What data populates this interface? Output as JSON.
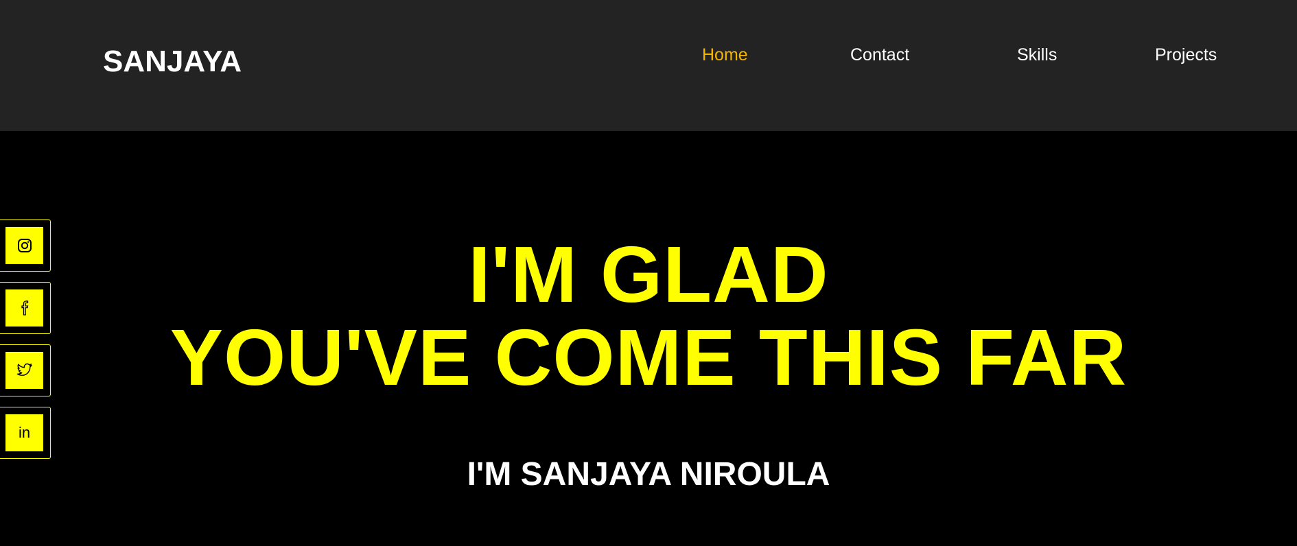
{
  "header": {
    "logo": "SANJAYA",
    "nav": {
      "home": "Home",
      "contact": "Contact",
      "skills": "Skills",
      "projects": "Projects"
    },
    "active_item": "Home"
  },
  "social": {
    "items": [
      {
        "name": "instagram",
        "icon": "instagram-icon"
      },
      {
        "name": "facebook",
        "icon": "facebook-icon"
      },
      {
        "name": "twitter",
        "icon": "twitter-icon"
      },
      {
        "name": "linkedin",
        "icon": "linkedin-icon",
        "glyph": "in"
      }
    ]
  },
  "hero": {
    "line1": "I'M GLAD",
    "line2": "YOU'VE COME THIS FAR",
    "subtitle": "I'M SANJAYA NIROULA"
  },
  "colors": {
    "background": "#000000",
    "header_background": "#232323",
    "accent_yellow": "#ffff00",
    "active_nav": "#f4b400",
    "text_white": "#ffffff"
  }
}
